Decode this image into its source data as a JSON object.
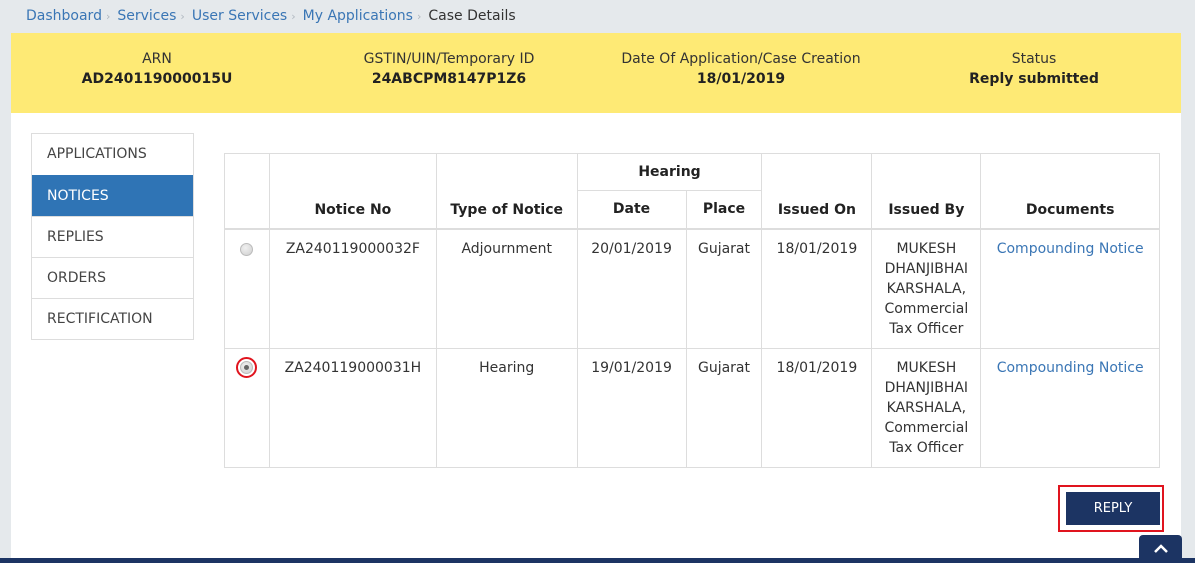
{
  "breadcrumb": {
    "items": [
      "Dashboard",
      "Services",
      "User Services",
      "My Applications"
    ],
    "current": "Case Details",
    "separator": "›"
  },
  "summary": {
    "arn_label": "ARN",
    "arn_value": "AD240119000015U",
    "gstin_label": "GSTIN/UIN/Temporary ID",
    "gstin_value": "24ABCPM8147P1Z6",
    "date_label": "Date Of Application/Case Creation",
    "date_value": "18/01/2019",
    "status_label": "Status",
    "status_value": "Reply submitted"
  },
  "sidenav": {
    "items": [
      "APPLICATIONS",
      "NOTICES",
      "REPLIES",
      "ORDERS",
      "RECTIFICATION"
    ],
    "active": "NOTICES"
  },
  "table": {
    "headers": {
      "notice_no": "Notice No",
      "type": "Type of Notice",
      "hearing": "Hearing",
      "date": "Date",
      "place": "Place",
      "issued_on": "Issued On",
      "issued_by": "Issued By",
      "documents": "Documents"
    },
    "rows": [
      {
        "selected": false,
        "notice_no": "ZA240119000032F",
        "type": "Adjournment",
        "date": "20/01/2019",
        "place": "Gujarat",
        "issued_on": "18/01/2019",
        "issued_by": "MUKESH DHANJIBHAI KARSHALA, Commercial Tax Officer",
        "document": "Compounding Notice"
      },
      {
        "selected": true,
        "notice_no": "ZA240119000031H",
        "type": "Hearing",
        "date": "19/01/2019",
        "place": "Gujarat",
        "issued_on": "18/01/2019",
        "issued_by": "MUKESH DHANJIBHAI KARSHALA, Commercial Tax Officer",
        "document": "Compounding Notice"
      }
    ]
  },
  "actions": {
    "reply_label": "REPLY",
    "scroll_top_icon": "chevron-up-icon"
  },
  "colors": {
    "summary_bg": "#feea75",
    "active_nav": "#2f74b5",
    "link": "#3a76b5",
    "primary_button": "#1c3463",
    "highlight": "#e0141e"
  }
}
